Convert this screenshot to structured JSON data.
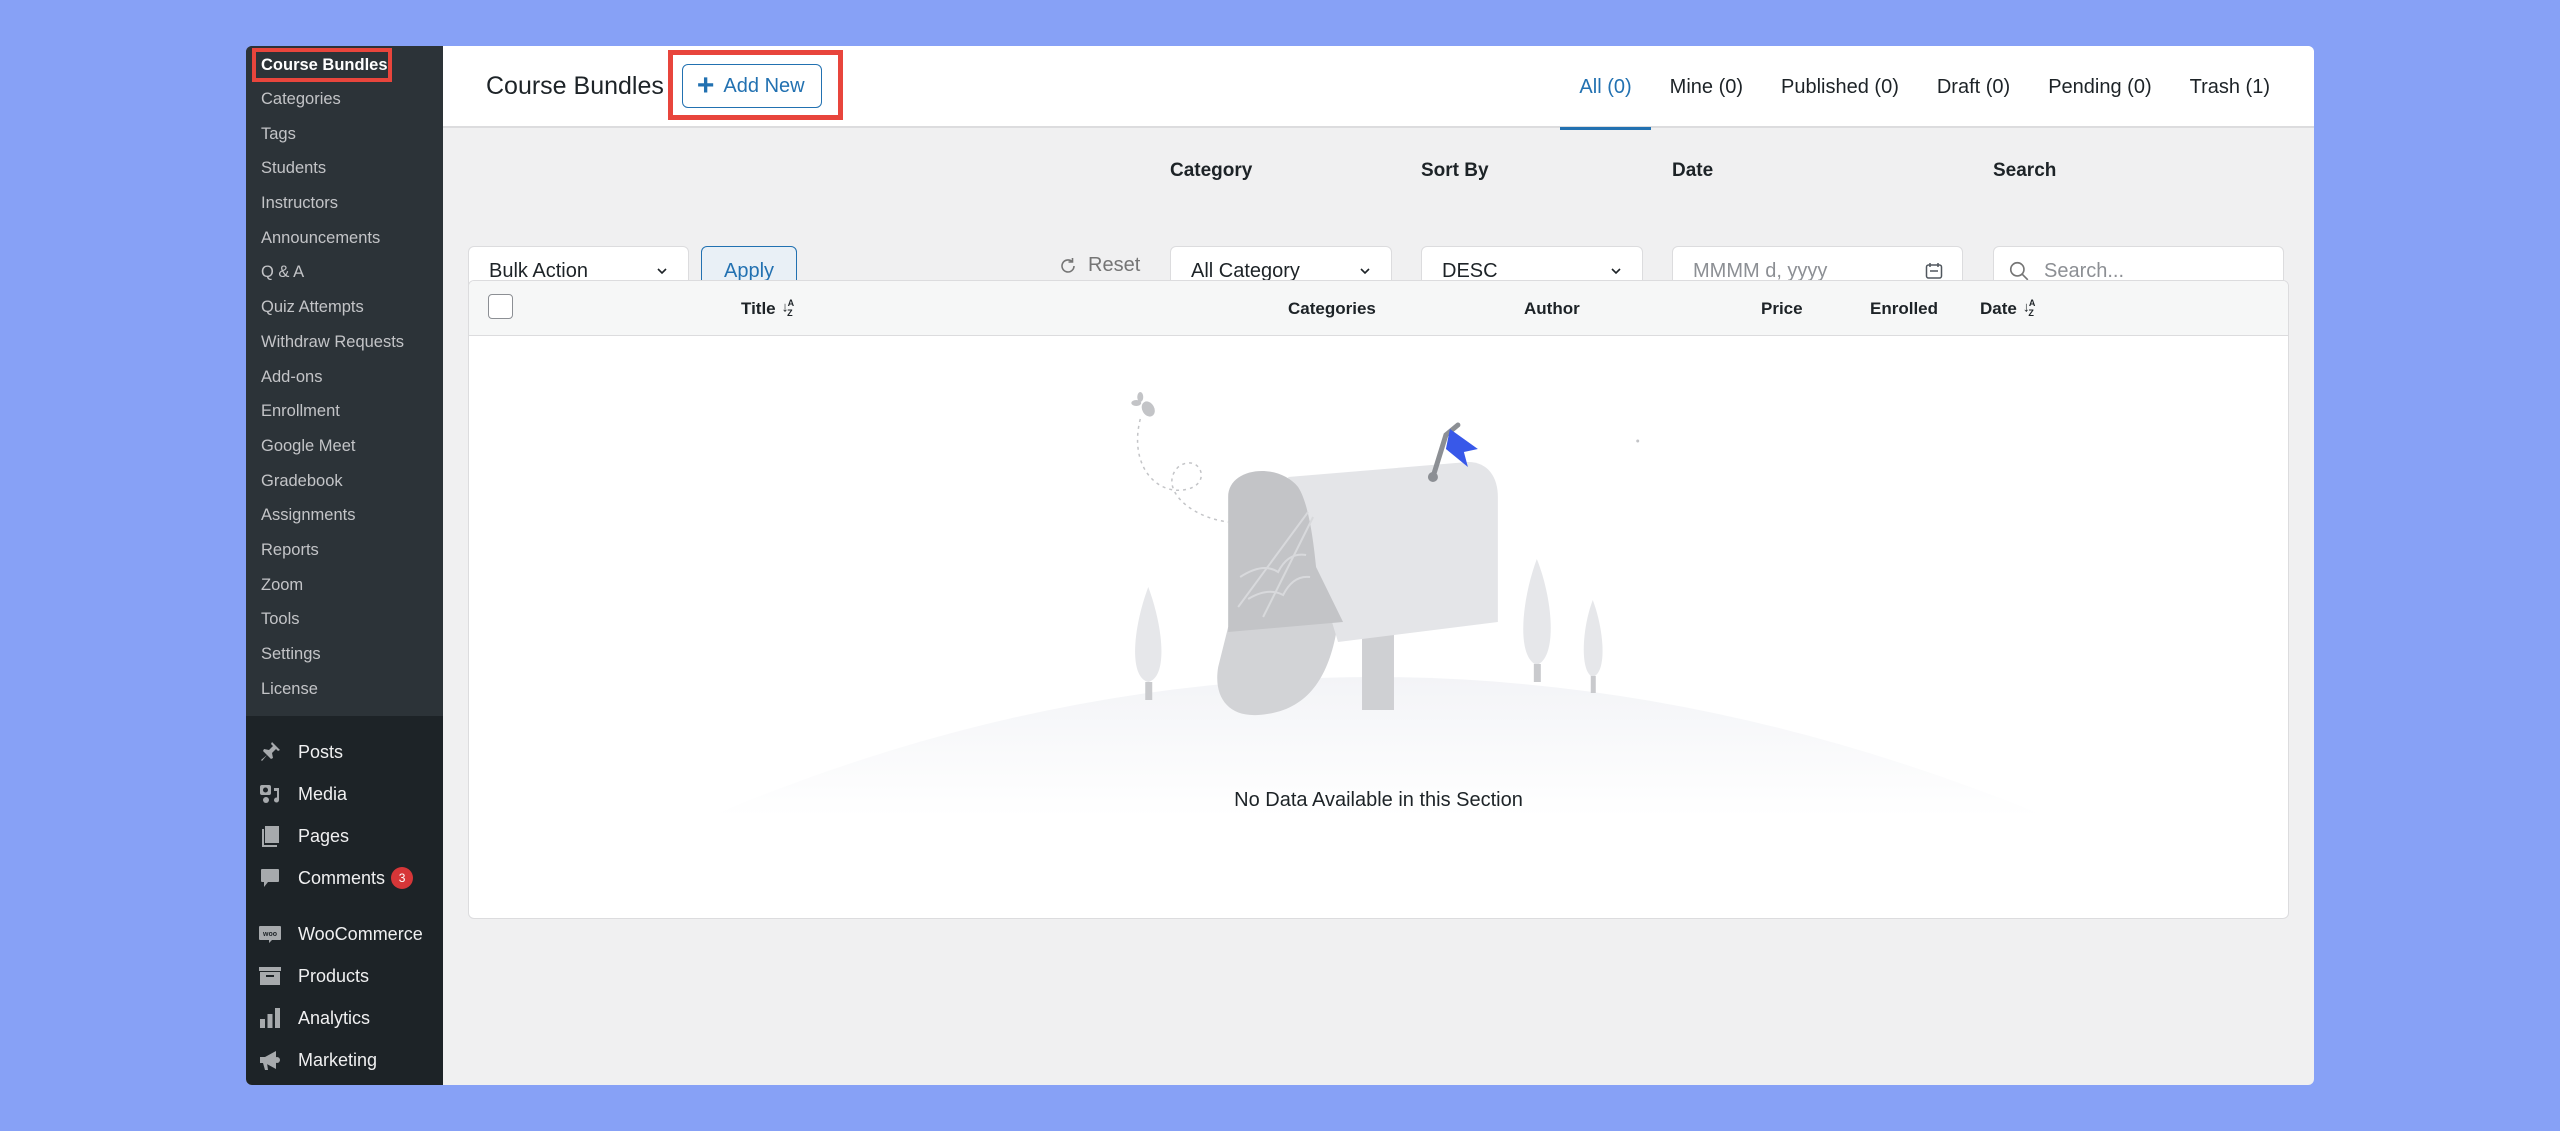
{
  "sidebar": {
    "submenu": [
      {
        "label": "Course Bundles",
        "current": true
      },
      {
        "label": "Categories"
      },
      {
        "label": "Tags"
      },
      {
        "label": "Students"
      },
      {
        "label": "Instructors"
      },
      {
        "label": "Announcements"
      },
      {
        "label": "Q & A"
      },
      {
        "label": "Quiz Attempts"
      },
      {
        "label": "Withdraw Requests"
      },
      {
        "label": "Add-ons"
      },
      {
        "label": "Enrollment"
      },
      {
        "label": "Google Meet"
      },
      {
        "label": "Gradebook"
      },
      {
        "label": "Assignments"
      },
      {
        "label": "Reports"
      },
      {
        "label": "Zoom"
      },
      {
        "label": "Tools"
      },
      {
        "label": "Settings"
      },
      {
        "label": "License"
      }
    ],
    "menu": [
      {
        "label": "Posts",
        "icon": "pin-icon"
      },
      {
        "label": "Media",
        "icon": "media-icon"
      },
      {
        "label": "Pages",
        "icon": "pages-icon"
      },
      {
        "label": "Comments",
        "icon": "comment-icon",
        "badge": "3"
      },
      {
        "label": "WooCommerce",
        "icon": "woo-icon"
      },
      {
        "label": "Products",
        "icon": "archive-icon"
      },
      {
        "label": "Analytics",
        "icon": "bar-chart-icon"
      },
      {
        "label": "Marketing",
        "icon": "megaphone-icon"
      }
    ]
  },
  "header": {
    "title": "Course Bundles",
    "add_new_label": "Add New",
    "tabs": [
      {
        "label": "All (0)",
        "active": true
      },
      {
        "label": "Mine (0)"
      },
      {
        "label": "Published (0)"
      },
      {
        "label": "Draft (0)"
      },
      {
        "label": "Pending (0)"
      },
      {
        "label": "Trash (1)"
      }
    ]
  },
  "filters": {
    "bulk_action": "Bulk Action",
    "apply_label": "Apply",
    "reset_label": "Reset",
    "category_label": "Category",
    "category_value": "All Category",
    "sort_label": "Sort By",
    "sort_value": "DESC",
    "date_label": "Date",
    "date_placeholder": "MMMM d, yyyy",
    "search_label": "Search",
    "search_placeholder": "Search..."
  },
  "table": {
    "columns": [
      "Title",
      "Categories",
      "Author",
      "Price",
      "Enrolled",
      "Date"
    ],
    "sort_glyph": "↓A/Z",
    "empty_message": "No Data Available in this Section"
  },
  "colors": {
    "accent": "#2271b1",
    "highlight": "#e8453c",
    "badge": "#d63638",
    "flag": "#3858e9"
  }
}
